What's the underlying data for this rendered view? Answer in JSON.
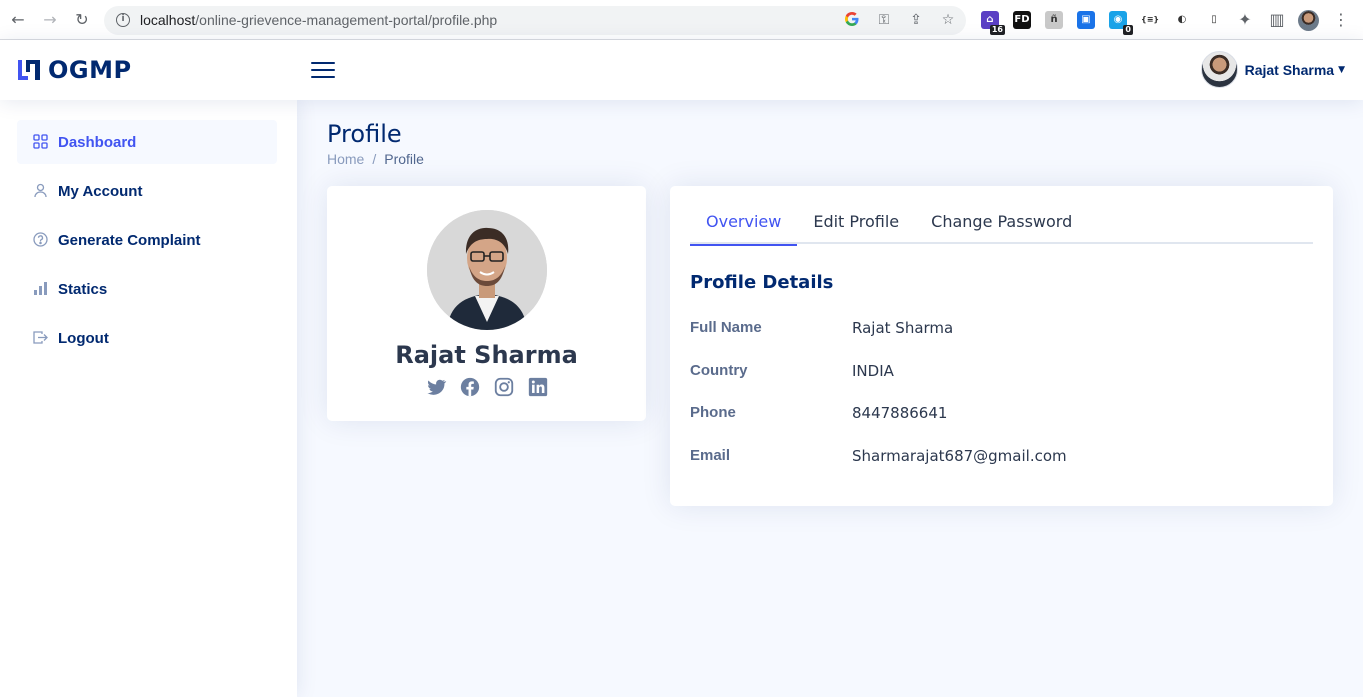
{
  "browser": {
    "url_host": "localhost",
    "url_path": "/online-grievence-management-portal/profile.php",
    "extensions": [
      {
        "name": "graduation-ext-icon",
        "badge": "16",
        "color": "#5b3fc4",
        "glyph": "⌂"
      },
      {
        "name": "fd-ext-icon",
        "badge": "",
        "color": "#111111",
        "glyph": "FD"
      },
      {
        "name": "gray-ext-icon",
        "badge": "",
        "color": "#c9c9c9",
        "glyph": "ñ"
      },
      {
        "name": "video-ext-icon",
        "badge": "",
        "color": "#1a73e8",
        "glyph": "▣"
      },
      {
        "name": "counter-ext-icon",
        "badge": "0",
        "color": "#1aa3e8",
        "glyph": "◉"
      },
      {
        "name": "json-ext-icon",
        "badge": "",
        "color": "#ffffff",
        "glyph": "{≡}"
      },
      {
        "name": "ghost-ext-icon",
        "badge": "",
        "color": "#ffffff",
        "glyph": "◐"
      },
      {
        "name": "file-ext-icon",
        "badge": "",
        "color": "#ffffff",
        "glyph": "▯"
      }
    ]
  },
  "header": {
    "logo_text": "OGMP",
    "user_name": "Rajat Sharma"
  },
  "sidebar": {
    "items": [
      {
        "label": "Dashboard",
        "icon": "grid-icon"
      },
      {
        "label": "My Account",
        "icon": "person-icon"
      },
      {
        "label": "Generate Complaint",
        "icon": "question-circle-icon"
      },
      {
        "label": "Statics",
        "icon": "bar-chart-icon"
      },
      {
        "label": "Logout",
        "icon": "box-arrow-right-icon"
      }
    ]
  },
  "page": {
    "title": "Profile",
    "breadcrumb": [
      "Home",
      "Profile"
    ]
  },
  "profile_card": {
    "name": "Rajat Sharma",
    "social": [
      "twitter-icon",
      "facebook-icon",
      "instagram-icon",
      "linkedin-icon"
    ]
  },
  "details": {
    "tabs": [
      "Overview",
      "Edit Profile",
      "Change Password"
    ],
    "active_tab": "Overview",
    "section_title": "Profile Details",
    "rows": [
      {
        "label": "Full Name",
        "value": "Rajat Sharma"
      },
      {
        "label": "Country",
        "value": "INDIA"
      },
      {
        "label": "Phone",
        "value": "8447886641"
      },
      {
        "label": "Email",
        "value": "Sharmarajat687@gmail.com"
      }
    ]
  },
  "colors": {
    "primary": "#4154f1",
    "navy": "#012970",
    "muted": "#899bbd",
    "background": "#f6f9ff"
  }
}
